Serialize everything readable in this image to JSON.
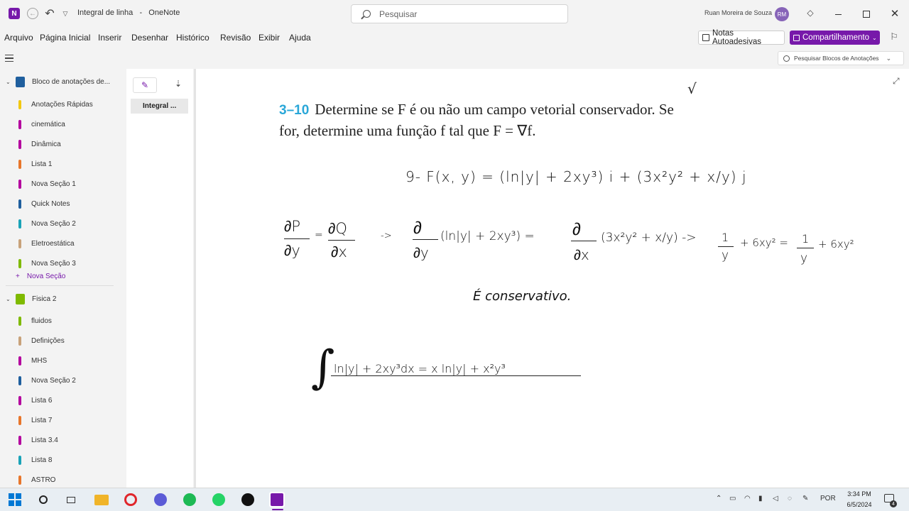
{
  "app": {
    "document_title": "Integral de linha",
    "app_name": "OneNote",
    "search_placeholder": "Pesquisar",
    "user_name": "Ruan Moreira de Souza",
    "user_initials": "RM"
  },
  "menu": [
    "Arquivo",
    "Página Inicial",
    "Inserir",
    "Desenhar",
    "Histórico",
    "Revisão",
    "Exibir",
    "Ajuda"
  ],
  "toolbar": {
    "notes_label": "Notas Autoadesivas",
    "share_label": "Compartilhamento",
    "notebook_search_placeholder": "Pesquisar Blocos de Anotações"
  },
  "notebooks": [
    {
      "title": "Bloco de anotações de...",
      "color": "#1f5f9e",
      "sections": [
        {
          "label": "Anotações Rápidas",
          "color": "#f2c811"
        },
        {
          "label": "cinemática",
          "color": "#b4009e"
        },
        {
          "label": "Dinâmica",
          "color": "#b4009e"
        },
        {
          "label": "Lista 1",
          "color": "#e8762b"
        },
        {
          "label": "Nova Seção 1",
          "color": "#b4009e"
        },
        {
          "label": "Quick Notes",
          "color": "#1f5f9e"
        },
        {
          "label": "Nova Seção 2",
          "color": "#1aa3b8"
        },
        {
          "label": "Eletroestática",
          "color": "#c8a27a"
        },
        {
          "label": "Nova Seção 3",
          "color": "#7fba00"
        }
      ],
      "new_section_label": "Nova Seção"
    },
    {
      "title": "Fisica 2",
      "color": "#7fba00",
      "sections": [
        {
          "label": "fluidos",
          "color": "#7fba00"
        },
        {
          "label": "Definições",
          "color": "#c8a27a"
        },
        {
          "label": "MHS",
          "color": "#b4009e"
        },
        {
          "label": "Nova Seção 2",
          "color": "#1f5f9e"
        },
        {
          "label": "Lista 6",
          "color": "#b4009e"
        },
        {
          "label": "Lista 7",
          "color": "#e8762b"
        },
        {
          "label": "Lista 3.4",
          "color": "#b4009e"
        },
        {
          "label": "Lista 8",
          "color": "#1aa3b8"
        },
        {
          "label": "ASTRO",
          "color": "#e8762b"
        }
      ]
    }
  ],
  "pages": [
    {
      "label": "Integral ..."
    }
  ],
  "note": {
    "problem_number": "3–10",
    "problem_line1": "Determine se F é ou não um campo vetorial conservador. Se",
    "problem_line2": "for, determine uma função f tal que F = ∇f.",
    "check": "√",
    "hw_field": "9-  F(x, y) = (ln|y| + 2xy³) i + (3x²y² + x/y) j",
    "hw_dp": "∂P",
    "hw_dy": "∂y",
    "hw_eq": "=",
    "hw_dq": "∂Q",
    "hw_dx": "∂x",
    "hw_arrow": "->",
    "hw_d1": "∂",
    "hw_d1y": "∂y",
    "hw_expr1": "(ln|y| + 2xy³) =",
    "hw_d2": "∂",
    "hw_d2x": "∂x",
    "hw_expr2": "(3x²y² + x/y) ->",
    "hw_one1": "1",
    "hw_y1": "y",
    "hw_expr3": "+ 6xy² =",
    "hw_one2": "1",
    "hw_y2": "y",
    "hw_expr4": "+ 6xy²",
    "hw_conclusion": "É conservativo.",
    "hw_integral": "ln|y| + 2xy³dx = x ln|y| + x²y³"
  },
  "taskbar": {
    "language": "POR",
    "time": "3:34 PM",
    "date": "6/5/2024",
    "notification_count": "4"
  }
}
